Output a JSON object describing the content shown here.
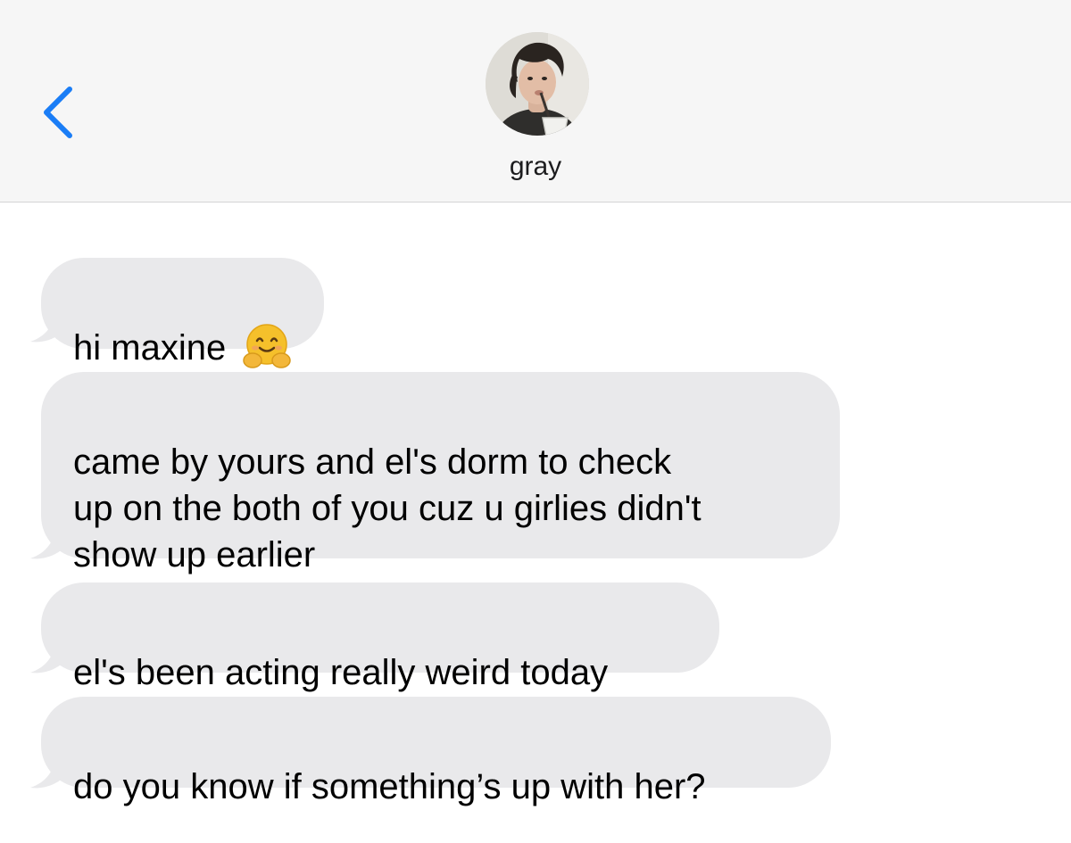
{
  "header": {
    "back_icon": "chevron-left-icon",
    "contact_name": "gray",
    "avatar_icon": "contact-photo",
    "accent_color": "#1a7df6"
  },
  "messages": [
    {
      "text": "hi maxine",
      "emoji": "hugging-face-emoji"
    },
    {
      "text": "came by yours and el's dorm to check\nup on the both of you cuz u girlies didn't\nshow up earlier"
    },
    {
      "text": "el's been acting really weird today"
    },
    {
      "text": "do you know if something’s up with her?"
    }
  ],
  "colors": {
    "header_bg": "#f6f6f6",
    "bubble_bg": "#e9e9eb",
    "text": "#000000"
  }
}
